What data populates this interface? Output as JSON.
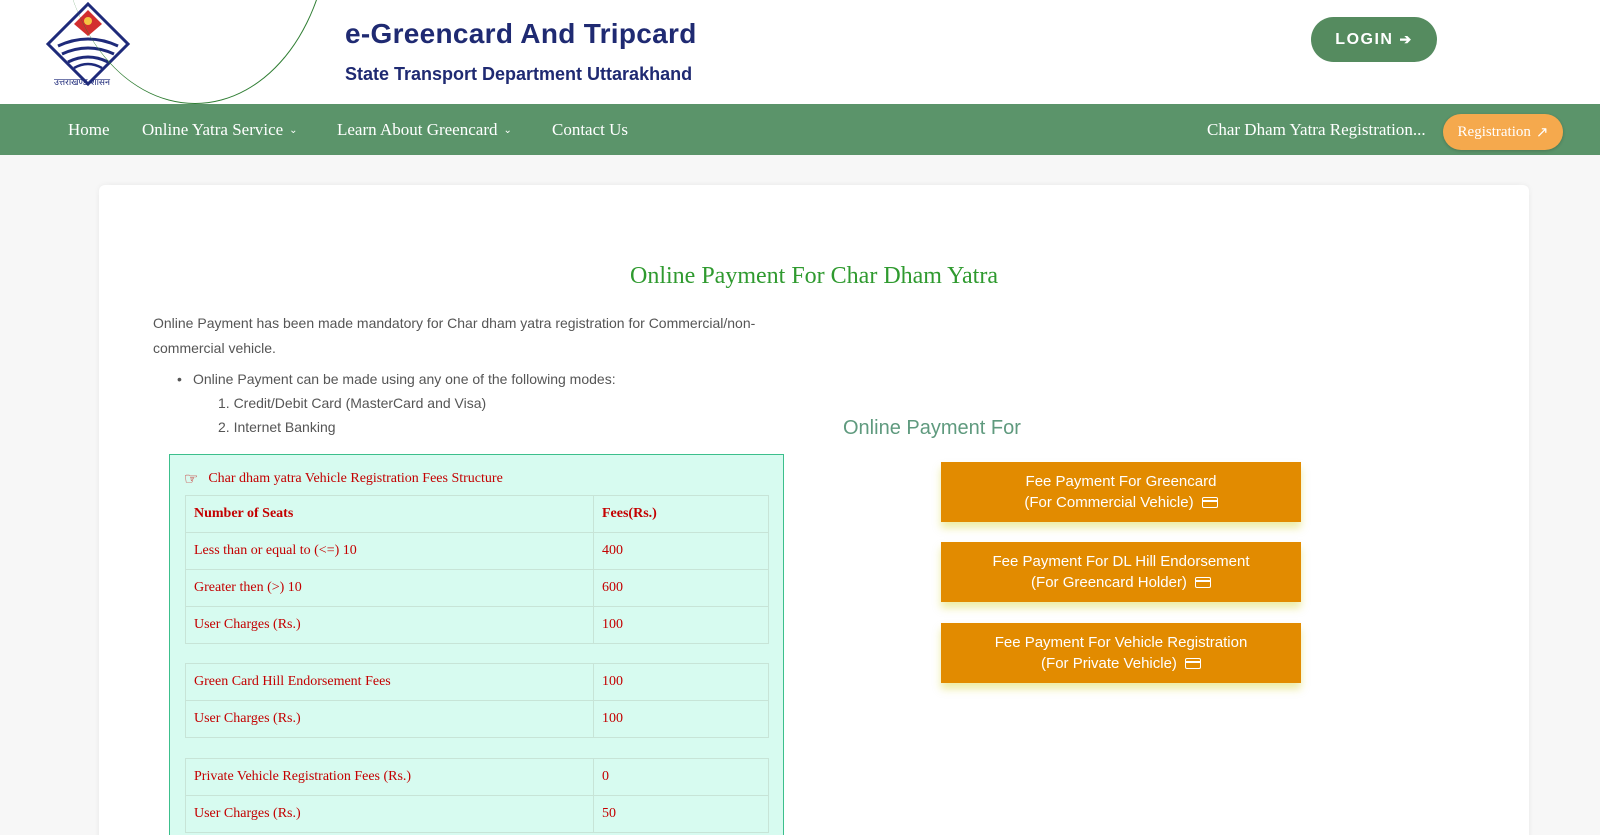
{
  "header": {
    "logo_caption": "उत्तराखण्ड शासन",
    "title": "e-Greencard And Tripcard",
    "subtitle": "State Transport Department Uttarakhand",
    "login_label": "LOGIN"
  },
  "nav": {
    "items": [
      {
        "label": "Home"
      },
      {
        "label": "Online Yatra Service"
      },
      {
        "label": "Learn About Greencard"
      },
      {
        "label": "Contact Us"
      }
    ],
    "char_dham_text": "Char Dham Yatra Registration...",
    "registration_label": "Registration"
  },
  "main": {
    "title": "Online Payment For Char Dham Yatra",
    "intro": "Online Payment has been made mandatory for Char dham yatra registration for Commercial/non-commercial vehicle.",
    "modes_intro": "Online Payment can be made using any one of the following modes:",
    "modes": [
      "1. Credit/Debit Card (MasterCard and Visa)",
      "2. Internet Banking"
    ]
  },
  "fees": {
    "heading": "Char dham yatra Vehicle Registration Fees Structure",
    "col_seats": "Number of Seats",
    "col_fees": "Fees(Rs.)",
    "group1": [
      {
        "label": "Less than or equal to (<=) 10",
        "value": "400"
      },
      {
        "label": "Greater then (>) 10",
        "value": "600"
      },
      {
        "label": "User Charges (Rs.)",
        "value": "100"
      }
    ],
    "group2": [
      {
        "label": "Green Card Hill Endorsement Fees",
        "value": "100"
      },
      {
        "label": "User Charges (Rs.)",
        "value": "100"
      }
    ],
    "group3": [
      {
        "label": "Private Vehicle Registration Fees (Rs.)",
        "value": "0"
      },
      {
        "label": "User Charges (Rs.)",
        "value": "50"
      }
    ]
  },
  "payment": {
    "heading": "Online Payment For",
    "buttons": [
      {
        "line1": "Fee Payment For Greencard",
        "line2": "(For Commercial Vehicle)"
      },
      {
        "line1": "Fee Payment For DL Hill Endorsement",
        "line2": "(For Greencard Holder)"
      },
      {
        "line1": "Fee Payment For Vehicle Registration",
        "line2": "(For Private Vehicle)"
      }
    ]
  },
  "colors": {
    "nav_green": "#5b946a",
    "title_blue": "#1f2a72",
    "payment_orange": "#e28b00",
    "registration_orange": "#f5a94d",
    "fees_red": "#c40000"
  }
}
